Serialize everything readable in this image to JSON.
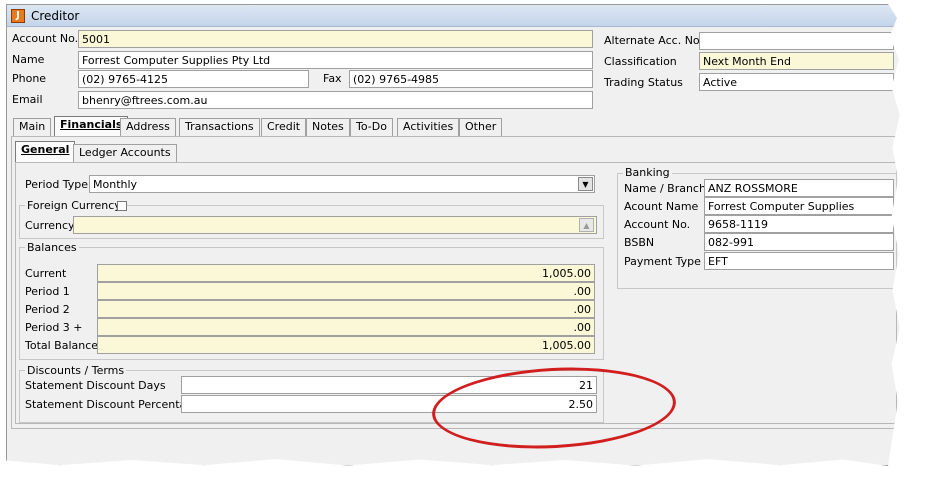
{
  "window": {
    "title": "Creditor",
    "icon": "app-logo-icon"
  },
  "header": {
    "account_no": {
      "label": "Account No.",
      "value": "5001"
    },
    "name": {
      "label": "Name",
      "value": "Forrest Computer Supplies Pty Ltd"
    },
    "phone": {
      "label": "Phone",
      "value": "(02) 9765-4125"
    },
    "fax": {
      "label": "Fax",
      "value": "(02) 9765-4985"
    },
    "email": {
      "label": "Email",
      "value": "bhenry@ftrees.com.au"
    },
    "alternate_acc_no": {
      "label": "Alternate Acc. No.",
      "value": ""
    },
    "classification": {
      "label": "Classification",
      "value": "Next Month End"
    },
    "trading_status": {
      "label": "Trading Status",
      "value": "Active"
    }
  },
  "tabs": [
    {
      "label": "Main",
      "active": false
    },
    {
      "label": "Financials",
      "active": true
    },
    {
      "label": "Address",
      "active": false
    },
    {
      "label": "Transactions",
      "active": false
    },
    {
      "label": "Credit",
      "active": false
    },
    {
      "label": "Notes",
      "active": false
    },
    {
      "label": "To-Do",
      "active": false
    },
    {
      "label": "Activities",
      "active": false
    },
    {
      "label": "Other",
      "active": false
    }
  ],
  "subtabs": [
    {
      "label": "General",
      "active": true
    },
    {
      "label": "Ledger Accounts",
      "active": false
    }
  ],
  "general": {
    "period_type": {
      "label": "Period Type",
      "value": "Monthly"
    },
    "foreign_currency": {
      "label": "Foreign Currency",
      "checked": false
    },
    "currency": {
      "label": "Currency",
      "value": ""
    },
    "balances": {
      "caption": "Balances",
      "rows": [
        {
          "label": "Current",
          "value": "1,005.00"
        },
        {
          "label": "Period 1",
          "value": ".00"
        },
        {
          "label": "Period 2",
          "value": ".00"
        },
        {
          "label": "Period 3 +",
          "value": ".00"
        },
        {
          "label": "Total Balance",
          "value": "1,005.00"
        }
      ]
    },
    "discounts": {
      "caption": "Discounts / Terms",
      "days": {
        "label": "Statement Discount Days",
        "value": "21"
      },
      "percentage": {
        "label": "Statement Discount Percentage",
        "value": "2.50"
      }
    },
    "banking": {
      "caption": "Banking",
      "name_branch": {
        "label": "Name / Branch",
        "value": "ANZ ROSSMORE"
      },
      "account_name": {
        "label": "Acount Name",
        "value": "Forrest Computer Supplies"
      },
      "account_no": {
        "label": "Account No.",
        "value": "9658-1119"
      },
      "bsbn": {
        "label": "BSBN",
        "value": "082-991"
      },
      "payment_type": {
        "label": "Payment Type",
        "value": "EFT"
      }
    }
  },
  "colors": {
    "highlight_field": "#fbf8d8",
    "annotation_ellipse": "#d11e1e"
  }
}
